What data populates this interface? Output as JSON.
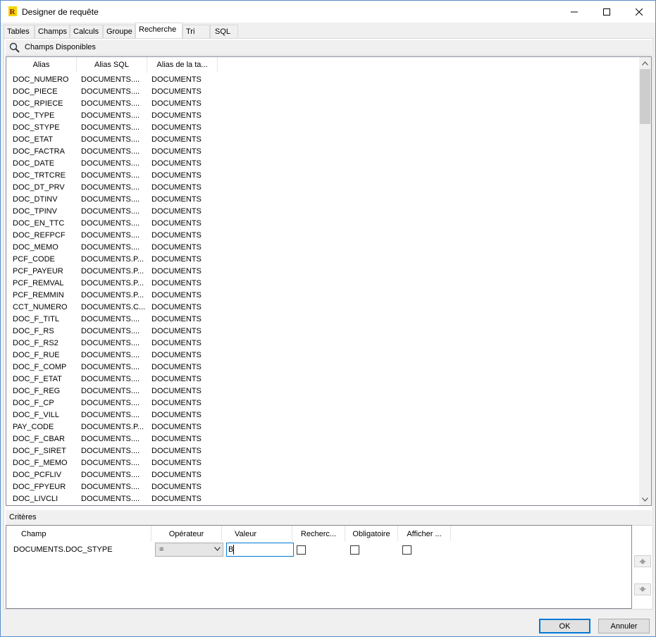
{
  "window": {
    "title": "Designer de requête",
    "icon": "query-designer-app-icon",
    "controls": [
      "minimize-icon",
      "maximize-icon",
      "close-icon"
    ]
  },
  "tabs": [
    {
      "label": "Tables"
    },
    {
      "label": "Champs"
    },
    {
      "label": "Calculs"
    },
    {
      "label": "Groupe"
    },
    {
      "label": "Recherche",
      "active": true
    },
    {
      "label": "Tri"
    },
    {
      "label": "SQL"
    }
  ],
  "available_fields": {
    "header": "Champs Disponibles",
    "icon": "search-icon",
    "columns": [
      "Alias",
      "Alias SQL",
      "Alias de la ta..."
    ],
    "rows": [
      [
        "DOC_NUMERO",
        "DOCUMENTS....",
        "DOCUMENTS"
      ],
      [
        "DOC_PIECE",
        "DOCUMENTS....",
        "DOCUMENTS"
      ],
      [
        "DOC_RPIECE",
        "DOCUMENTS....",
        "DOCUMENTS"
      ],
      [
        "DOC_TYPE",
        "DOCUMENTS....",
        "DOCUMENTS"
      ],
      [
        "DOC_STYPE",
        "DOCUMENTS....",
        "DOCUMENTS"
      ],
      [
        "DOC_ETAT",
        "DOCUMENTS....",
        "DOCUMENTS"
      ],
      [
        "DOC_FACTRA",
        "DOCUMENTS....",
        "DOCUMENTS"
      ],
      [
        "DOC_DATE",
        "DOCUMENTS....",
        "DOCUMENTS"
      ],
      [
        "DOC_TRTCRE",
        "DOCUMENTS....",
        "DOCUMENTS"
      ],
      [
        "DOC_DT_PRV",
        "DOCUMENTS....",
        "DOCUMENTS"
      ],
      [
        "DOC_DTINV",
        "DOCUMENTS....",
        "DOCUMENTS"
      ],
      [
        "DOC_TPINV",
        "DOCUMENTS....",
        "DOCUMENTS"
      ],
      [
        "DOC_EN_TTC",
        "DOCUMENTS....",
        "DOCUMENTS"
      ],
      [
        "DOC_REFPCF",
        "DOCUMENTS....",
        "DOCUMENTS"
      ],
      [
        "DOC_MEMO",
        "DOCUMENTS....",
        "DOCUMENTS"
      ],
      [
        "PCF_CODE",
        "DOCUMENTS.P...",
        "DOCUMENTS"
      ],
      [
        "PCF_PAYEUR",
        "DOCUMENTS.P...",
        "DOCUMENTS"
      ],
      [
        "PCF_REMVAL",
        "DOCUMENTS.P...",
        "DOCUMENTS"
      ],
      [
        "PCF_REMMIN",
        "DOCUMENTS.P...",
        "DOCUMENTS"
      ],
      [
        "CCT_NUMERO",
        "DOCUMENTS.C...",
        "DOCUMENTS"
      ],
      [
        "DOC_F_TITL",
        "DOCUMENTS....",
        "DOCUMENTS"
      ],
      [
        "DOC_F_RS",
        "DOCUMENTS....",
        "DOCUMENTS"
      ],
      [
        "DOC_F_RS2",
        "DOCUMENTS....",
        "DOCUMENTS"
      ],
      [
        "DOC_F_RUE",
        "DOCUMENTS....",
        "DOCUMENTS"
      ],
      [
        "DOC_F_COMP",
        "DOCUMENTS....",
        "DOCUMENTS"
      ],
      [
        "DOC_F_ETAT",
        "DOCUMENTS....",
        "DOCUMENTS"
      ],
      [
        "DOC_F_REG",
        "DOCUMENTS....",
        "DOCUMENTS"
      ],
      [
        "DOC_F_CP",
        "DOCUMENTS....",
        "DOCUMENTS"
      ],
      [
        "DOC_F_VILL",
        "DOCUMENTS....",
        "DOCUMENTS"
      ],
      [
        "PAY_CODE",
        "DOCUMENTS.P...",
        "DOCUMENTS"
      ],
      [
        "DOC_F_CBAR",
        "DOCUMENTS....",
        "DOCUMENTS"
      ],
      [
        "DOC_F_SIRET",
        "DOCUMENTS....",
        "DOCUMENTS"
      ],
      [
        "DOC_F_MEMO",
        "DOCUMENTS....",
        "DOCUMENTS"
      ],
      [
        "DOC_PCFLIV",
        "DOCUMENTS....",
        "DOCUMENTS"
      ],
      [
        "DOC_FPYEUR",
        "DOCUMENTS....",
        "DOCUMENTS"
      ],
      [
        "DOC_LIVCLI",
        "DOCUMENTS....",
        "DOCUMENTS"
      ]
    ]
  },
  "criteria": {
    "header": "Critères",
    "columns": [
      "Champ",
      "Opérateur",
      "Valeur",
      "Recherc...",
      "Obligatoire",
      "Afficher ..."
    ],
    "row": {
      "champ": "DOCUMENTS.DOC_STYPE",
      "operateur": "=",
      "valeur": "B",
      "recherche": false,
      "obligatoire": false,
      "afficher": false
    },
    "side_buttons": [
      "move-up-icon",
      "move-down-icon"
    ]
  },
  "buttons": {
    "ok": "OK",
    "cancel": "Annuler"
  }
}
